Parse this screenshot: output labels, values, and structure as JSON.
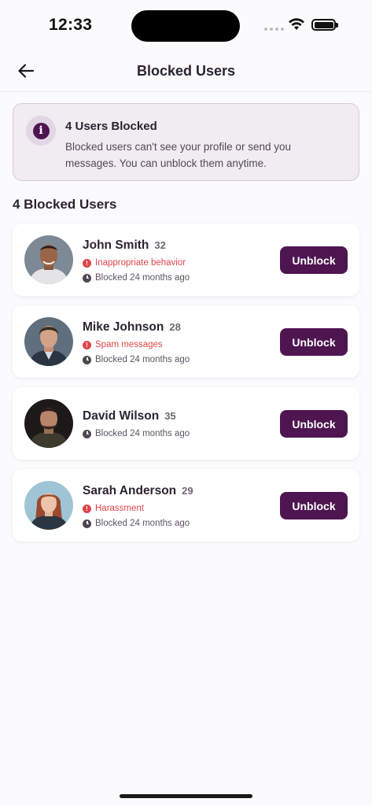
{
  "status_bar": {
    "time": "12:33"
  },
  "header": {
    "title": "Blocked Users",
    "back_icon": "arrow-left-icon"
  },
  "info_banner": {
    "icon": "info-icon",
    "title": "4 Users Blocked",
    "description": "Blocked users can't see your profile or send you messages. You can unblock them anytime."
  },
  "section_title": "4 Blocked Users",
  "colors": {
    "accent": "#4e1550",
    "reason": "#e0464b",
    "banner_bg": "#f1ebf2"
  },
  "users": [
    {
      "name": "John Smith",
      "age": "32",
      "reason": "Inappropriate behavior",
      "blocked_time": "Blocked 24 months ago",
      "button_label": "Unblock"
    },
    {
      "name": "Mike Johnson",
      "age": "28",
      "reason": "Spam messages",
      "blocked_time": "Blocked 24 months ago",
      "button_label": "Unblock"
    },
    {
      "name": "David Wilson",
      "age": "35",
      "reason": "",
      "blocked_time": "Blocked 24 months ago",
      "button_label": "Unblock"
    },
    {
      "name": "Sarah Anderson",
      "age": "29",
      "reason": "Harassment",
      "blocked_time": "Blocked 24 months ago",
      "button_label": "Unblock"
    }
  ]
}
